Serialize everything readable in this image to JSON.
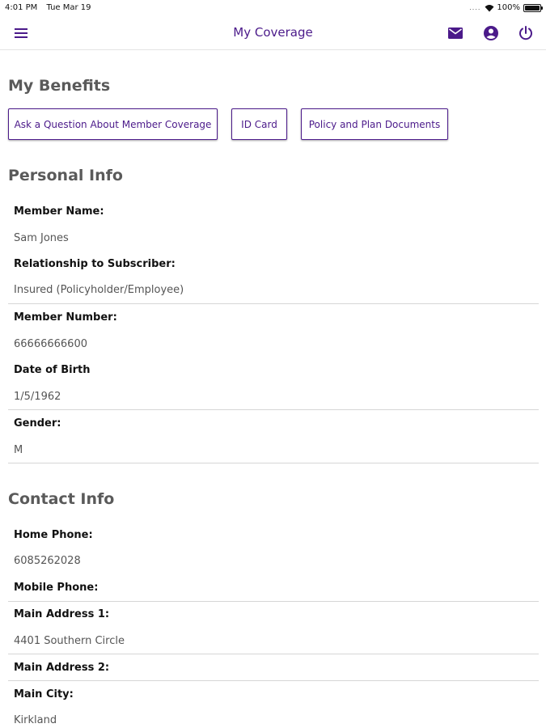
{
  "status_bar": {
    "time": "4:01 PM",
    "date": "Tue Mar 19",
    "signal": "....",
    "battery": "100%"
  },
  "nav": {
    "title": "My Coverage",
    "icons": [
      "menu-icon",
      "mail-icon",
      "account-icon",
      "power-icon"
    ],
    "accent_color": "#4b1a8a"
  },
  "benefits": {
    "title": "My Benefits",
    "buttons": [
      "Ask a Question About Member Coverage",
      "ID Card",
      "Policy and Plan Documents"
    ]
  },
  "personal_info": {
    "title": "Personal Info",
    "fields": [
      {
        "label": "Member Name:",
        "value": "Sam Jones"
      },
      {
        "label": "Relationship to Subscriber:",
        "value": "Insured (Policyholder/Employee)"
      },
      {
        "label": "Member Number:",
        "value": "66666666600"
      },
      {
        "label": "Date of Birth",
        "value": "1/5/1962"
      },
      {
        "label": "Gender:",
        "value": "M"
      }
    ]
  },
  "contact_info": {
    "title": "Contact Info",
    "fields": [
      {
        "label": "Home Phone:",
        "value": "6085262028"
      },
      {
        "label": "Mobile Phone:",
        "value": ""
      },
      {
        "label": "Main Address 1:",
        "value": "4401 Southern Circle"
      },
      {
        "label": "Main Address 2:",
        "value": ""
      },
      {
        "label": "Main City:",
        "value": "Kirkland"
      }
    ]
  }
}
